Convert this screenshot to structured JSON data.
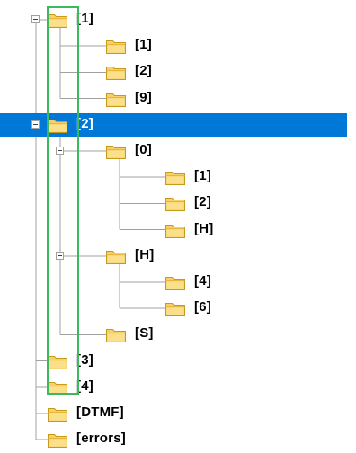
{
  "tree": {
    "nodes": [
      {
        "label": "[1]",
        "level": 0,
        "expanded": true,
        "selected": false
      },
      {
        "label": "[1]",
        "level": 1
      },
      {
        "label": "[2]",
        "level": 1
      },
      {
        "label": "[9]",
        "level": 1
      },
      {
        "label": "[2]",
        "level": 0,
        "expanded": true,
        "selected": true
      },
      {
        "label": "[0]",
        "level": 1,
        "expanded": true
      },
      {
        "label": "[1]",
        "level": 2
      },
      {
        "label": "[2]",
        "level": 2
      },
      {
        "label": "[H]",
        "level": 2
      },
      {
        "label": "[H]",
        "level": 1,
        "expanded": true
      },
      {
        "label": "[4]",
        "level": 2
      },
      {
        "label": "[6]",
        "level": 2
      },
      {
        "label": "[S]",
        "level": 1
      },
      {
        "label": "[3]",
        "level": 0
      },
      {
        "label": "[4]",
        "level": 0
      },
      {
        "label": "[DTMF]",
        "level": 0
      },
      {
        "label": "[errors]",
        "level": 0
      }
    ]
  },
  "colors": {
    "selection": "#0078d7",
    "folder_fill": "#f6d06a",
    "folder_stroke": "#c79a1c",
    "overlay_box": "#3cb95c"
  }
}
